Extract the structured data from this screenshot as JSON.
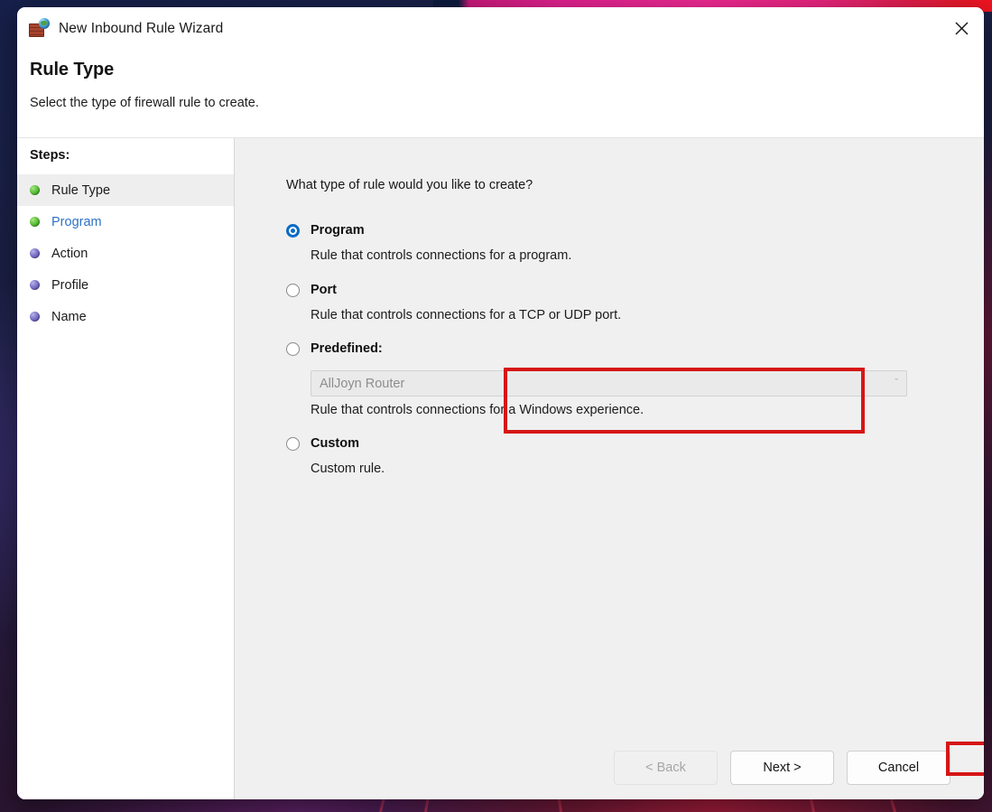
{
  "window": {
    "title": "New Inbound Rule Wizard",
    "icon": "firewall-brick-wall-globe-icon",
    "close_label": "✕"
  },
  "header": {
    "heading": "Rule Type",
    "subheading": "Select the type of firewall rule to create."
  },
  "sidebar": {
    "label": "Steps:",
    "items": [
      {
        "label": "Rule Type",
        "state": "current",
        "bullet": "green"
      },
      {
        "label": "Program",
        "state": "link",
        "bullet": "green"
      },
      {
        "label": "Action",
        "state": "pending",
        "bullet": "purple"
      },
      {
        "label": "Profile",
        "state": "pending",
        "bullet": "purple"
      },
      {
        "label": "Name",
        "state": "pending",
        "bullet": "purple"
      }
    ]
  },
  "content": {
    "question": "What type of rule would you like to create?",
    "options": [
      {
        "id": "program",
        "title": "Program",
        "description": "Rule that controls connections for a program.",
        "selected": true
      },
      {
        "id": "port",
        "title": "Port",
        "description": "Rule that controls connections for a TCP or UDP port.",
        "selected": false
      },
      {
        "id": "predefined",
        "title": "Predefined:",
        "description": "Rule that controls connections for a Windows experience.",
        "selected": false,
        "dropdown": {
          "value": "AllJoyn Router",
          "chevron": "ˇ",
          "disabled": true
        }
      },
      {
        "id": "custom",
        "title": "Custom",
        "description": "Custom rule.",
        "selected": false
      }
    ]
  },
  "footer": {
    "back_label": "< Back",
    "next_label": "Next >",
    "cancel_label": "Cancel",
    "back_disabled": true
  },
  "annotations": {
    "highlight_color": "#d61616",
    "highlighted_elements": [
      "program-option",
      "next-button"
    ]
  },
  "colors": {
    "accent_blue": "#0a6cc4",
    "link_blue": "#2f72c4",
    "panel_bg": "#f0f0f0",
    "dialog_bg": "#ffffff",
    "bullet_done": "#5ec13c",
    "bullet_pending": "#7a72c9"
  }
}
